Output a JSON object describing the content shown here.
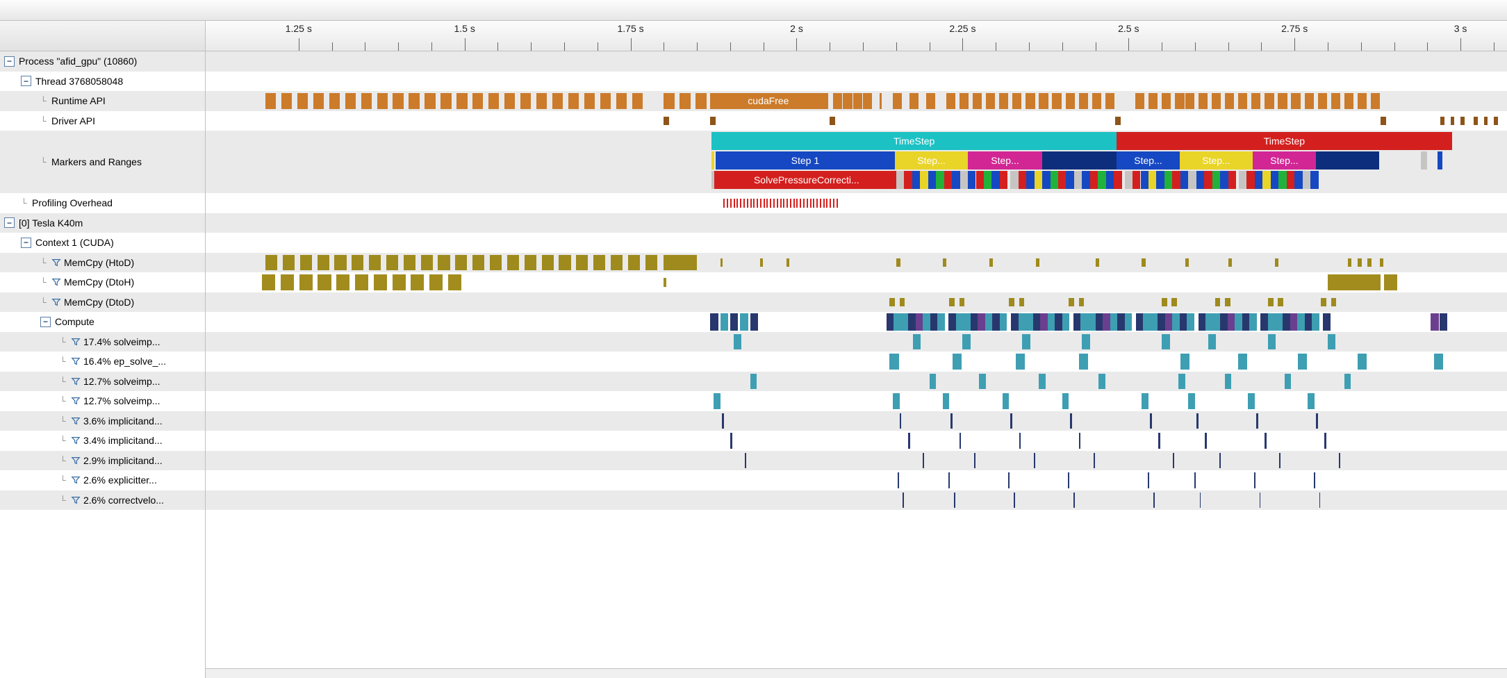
{
  "ruler": {
    "ticks": [
      "1.25 s",
      "1.5 s",
      "1.75 s",
      "2 s",
      "2.25 s",
      "2.5 s",
      "2.75 s",
      "3 s"
    ]
  },
  "tree": {
    "process": "Process \"afid_gpu\" (10860)",
    "thread": "Thread 3768058048",
    "runtime_api": "Runtime API",
    "driver_api": "Driver API",
    "markers": "Markers and Ranges",
    "profiling": "Profiling Overhead",
    "device": "[0] Tesla K40m",
    "context": "Context 1 (CUDA)",
    "memcpy_htod": "MemCpy (HtoD)",
    "memcpy_dtoh": "MemCpy (DtoH)",
    "memcpy_dtod": "MemCpy (DtoD)",
    "compute": "Compute",
    "k1": "17.4% solveimp...",
    "k2": "16.4% ep_solve_...",
    "k3": "12.7% solveimp...",
    "k4": "12.7% solveimp...",
    "k5": "3.6% implicitand...",
    "k6": "3.4% implicitand...",
    "k7": "2.9% implicitand...",
    "k8": "2.6% explicitter...",
    "k9": "2.6% correctvelo..."
  },
  "bars": {
    "cudaFree": "cudaFree",
    "timestep": "TimeStep",
    "step1": "Step    1",
    "step": "Step...",
    "solvep": "SolvePressureCorrecti..."
  }
}
